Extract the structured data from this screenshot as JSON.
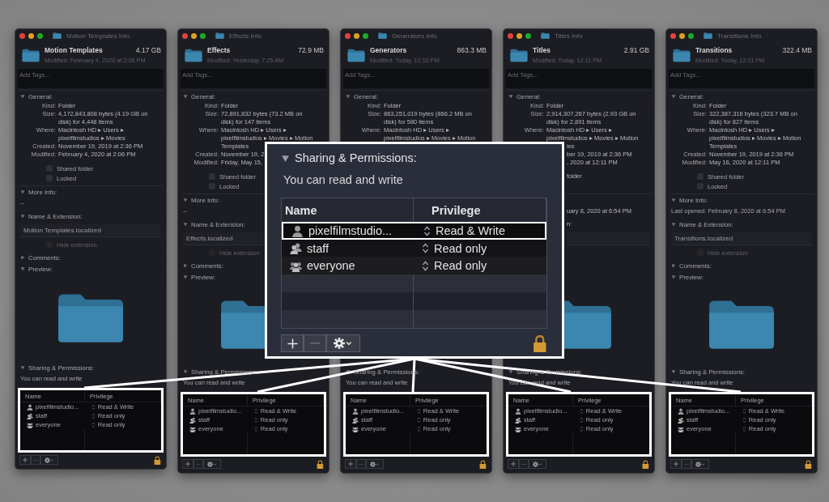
{
  "windows": [
    {
      "title": "Motion Templates Info",
      "name": "Motion Templates",
      "size": "4.17 GB",
      "modified": "Modified: February 4, 2020 at 2:06 PM",
      "tags": {
        "placeholder": "Add Tags..."
      },
      "general": {
        "title": "General:",
        "expanded": true,
        "rows": [
          {
            "label": "Kind:",
            "lines": [
              "Folder"
            ]
          },
          {
            "label": "Size:",
            "lines": [
              "4,172,843,808 bytes (4.19 GB on",
              "disk) for 4,448 items"
            ]
          },
          {
            "label": "Where:",
            "lines": [
              "Macintosh HD ▸ Users ▸",
              "pixelfilmstudios ▸ Movies"
            ]
          },
          {
            "label": "Created:",
            "lines": [
              "November 19, 2019 at 2:36 PM"
            ]
          },
          {
            "label": "Modified:",
            "lines": [
              "February 4, 2020 at 2:06 PM"
            ]
          }
        ],
        "options": [
          {
            "label": "Shared folder",
            "checked": false
          },
          {
            "label": "Locked",
            "checked": false
          }
        ]
      },
      "more_info": {
        "title": "More Info:",
        "expanded": true,
        "lines": [
          "--"
        ]
      },
      "name_ext": {
        "title": "Name & Extension:",
        "expanded": true,
        "value": "Motion Templates.localized",
        "hide_extension": {
          "label": "Hide extension",
          "checked": false,
          "disabled": true
        }
      },
      "comments": {
        "title": "Comments:",
        "expanded": false
      },
      "preview": {
        "title": "Preview:",
        "expanded": true,
        "kind": "folder"
      },
      "sharing": {
        "title": "Sharing & Permissions:",
        "expanded": true,
        "note": "You can read and write",
        "highlighted": true,
        "columns": [
          "Name",
          "Privilege"
        ],
        "rows": [
          {
            "name": "pixelfilmstudio...",
            "kind": "user",
            "privilege": "Read & Write"
          },
          {
            "name": "staff",
            "kind": "group",
            "privilege": "Read only"
          },
          {
            "name": "everyone",
            "kind": "everyone",
            "privilege": "Read only"
          }
        ]
      }
    },
    {
      "title": "Effects Info",
      "name": "Effects",
      "size": "72.9 MB",
      "modified": "Modified: Yesterday, 7:25 AM",
      "tags": {
        "placeholder": "Add Tags..."
      },
      "general": {
        "title": "General:",
        "expanded": true,
        "rows": [
          {
            "label": "Kind:",
            "lines": [
              "Folder"
            ]
          },
          {
            "label": "Size:",
            "lines": [
              "72,891,832 bytes (73.2 MB on",
              "disk) for 147 items"
            ]
          },
          {
            "label": "Where:",
            "lines": [
              "Macintosh HD ▸ Users ▸",
              "pixelfilmstudios ▸ Movies ▸ Motion",
              "Templates"
            ]
          },
          {
            "label": "Created:",
            "lines": [
              "November 19, 2"
            ]
          },
          {
            "label": "Modified:",
            "lines": [
              "Friday, May 15,"
            ]
          }
        ],
        "options": [
          {
            "label": "Shared folder",
            "checked": false
          },
          {
            "label": "Locked",
            "checked": false
          }
        ]
      },
      "more_info": {
        "title": "More Info:",
        "expanded": true,
        "lines": [
          "--"
        ]
      },
      "name_ext": {
        "title": "Name & Extension:",
        "expanded": true,
        "value": "Effects.localized",
        "hide_extension": {
          "label": "Hide extension",
          "checked": false,
          "disabled": true
        }
      },
      "comments": {
        "title": "Comments:",
        "expanded": false
      },
      "preview": {
        "title": "Preview:",
        "expanded": true,
        "kind": "folder"
      },
      "sharing": {
        "title": "Sharing & Permissions:",
        "expanded": true,
        "note": "You can read and write",
        "highlighted": true,
        "columns": [
          "Name",
          "Privilege"
        ],
        "rows": [
          {
            "name": "pixelfilmstudio...",
            "kind": "user",
            "privilege": "Read & Write"
          },
          {
            "name": "staff",
            "kind": "group",
            "privilege": "Read only"
          },
          {
            "name": "everyone",
            "kind": "everyone",
            "privilege": "Read only"
          }
        ]
      }
    },
    {
      "title": "Generators Info",
      "name": "Generators",
      "size": "863.3 MB",
      "modified": "Modified: Today, 12:10 PM",
      "tags": {
        "placeholder": "Add Tags..."
      },
      "general": {
        "title": "General:",
        "expanded": true,
        "rows": [
          {
            "label": "Kind:",
            "lines": [
              "Folder"
            ]
          },
          {
            "label": "Size:",
            "lines": [
              "863,251,019 bytes (866.2 MB on",
              "disk) for 580 items"
            ]
          },
          {
            "label": "Where:",
            "lines": [
              "Macintosh HD ▸ Users ▸",
              "pixelfilmstudios ▸ Movies ▸ Motion"
            ]
          }
        ]
      },
      "sharing": {
        "title": "Sharing & Permissions:",
        "expanded": true,
        "note": "You can read and write",
        "highlighted": true,
        "columns": [
          "Name",
          "Privilege"
        ],
        "rows": [
          {
            "name": "pixelfilmstudio...",
            "kind": "user",
            "privilege": "Read & Write"
          },
          {
            "name": "staff",
            "kind": "group",
            "privilege": "Read only"
          },
          {
            "name": "everyone",
            "kind": "everyone",
            "privilege": "Read only"
          }
        ]
      }
    },
    {
      "title": "Titles Info",
      "name": "Titles",
      "size": "2.91 GB",
      "modified": "Modified: Today, 12:11 PM",
      "tags": {
        "placeholder": "Add Tags..."
      },
      "general": {
        "title": "General:",
        "expanded": true,
        "rows": [
          {
            "label": "Kind:",
            "lines": [
              "Folder"
            ]
          },
          {
            "label": "Size:",
            "lines": [
              "2,914,307,267 bytes (2.93 GB on",
              "disk) for 2,891 items"
            ]
          },
          {
            "label": "Where:",
            "lines": [
              "Macintosh HD ▸ Users ▸",
              "pixelfilmstudios ▸ Movies ▸ Motion"
            ]
          },
          {
            "lines": [
              "ies"
            ],
            "clipped": true
          },
          {
            "lines": [
              "ber 19, 2019 at 2:36 PM"
            ],
            "clipped": true
          },
          {
            "lines": [
              ", 2020 at 12:11 PM"
            ],
            "clipped": true
          }
        ],
        "options": [
          {
            "label": "folder",
            "clipped": true
          }
        ]
      },
      "more_info": {
        "lines": [
          "uary 8, 2020 at 6:54 PM"
        ],
        "clipped": true
      },
      "name_ext": {
        "title": "n:",
        "clipped": true
      },
      "preview": {
        "kind": "folder"
      },
      "sharing": {
        "title": "Sharing & Permissions:",
        "expanded": true,
        "note": "You can read and write",
        "highlighted": true,
        "columns": [
          "Name",
          "Privilege"
        ],
        "rows": [
          {
            "name": "pixelfilmstudio...",
            "kind": "user",
            "privilege": "Read & Write"
          },
          {
            "name": "staff",
            "kind": "group",
            "privilege": "Read only"
          },
          {
            "name": "everyone",
            "kind": "everyone",
            "privilege": "Read only"
          }
        ]
      }
    },
    {
      "title": "Transitions Info",
      "name": "Transitions",
      "size": "322.4 MB",
      "modified": "Modified: Today, 12:11 PM",
      "tags": {
        "placeholder": "Add Tags..."
      },
      "general": {
        "title": "General:",
        "expanded": true,
        "rows": [
          {
            "label": "Kind:",
            "lines": [
              "Folder"
            ]
          },
          {
            "label": "Size:",
            "lines": [
              "322,387,316 bytes (323.7 MB on",
              "disk) for 827 items"
            ]
          },
          {
            "label": "Where:",
            "lines": [
              "Macintosh HD ▸ Users ▸",
              "pixelfilmstudios ▸ Movies ▸ Motion",
              "Templates"
            ]
          },
          {
            "label": "Created:",
            "lines": [
              "November 19, 2019 at 2:36 PM"
            ]
          },
          {
            "label": "Modified:",
            "lines": [
              "May 16, 2020 at 12:11 PM"
            ]
          }
        ],
        "options": [
          {
            "label": "Shared folder",
            "checked": false
          },
          {
            "label": "Locked",
            "checked": false
          }
        ]
      },
      "more_info": {
        "title": "More Info:",
        "expanded": true,
        "lines": [
          "Last opened: February 8, 2020 at 6:54 PM"
        ]
      },
      "name_ext": {
        "title": "Name & Extension:",
        "expanded": true,
        "value": "Transitions.localized",
        "hide_extension": {
          "label": "Hide extension",
          "checked": false,
          "disabled": true
        }
      },
      "comments": {
        "title": "Comments:",
        "expanded": false
      },
      "preview": {
        "title": "Preview:",
        "expanded": true,
        "kind": "folder"
      },
      "sharing": {
        "title": "Sharing & Permissions:",
        "expanded": true,
        "note": "You can read and write",
        "highlighted": true,
        "columns": [
          "Name",
          "Privilege"
        ],
        "rows": [
          {
            "name": "pixelfilmstudio...",
            "kind": "user",
            "privilege": "Read & Write"
          },
          {
            "name": "staff",
            "kind": "group",
            "privilege": "Read only"
          },
          {
            "name": "everyone",
            "kind": "everyone",
            "privilege": "Read only"
          }
        ]
      }
    }
  ],
  "callout": {
    "title": "Sharing & Permissions:",
    "expanded": true,
    "note": "You can read and write",
    "columns": [
      "Name",
      "Privilege"
    ],
    "rows": [
      {
        "name": "pixelfilmstudio...",
        "kind": "user",
        "privilege": "Read & Write",
        "selected": true
      },
      {
        "name": "staff",
        "kind": "group",
        "privilege": "Read only",
        "selected": false
      },
      {
        "name": "everyone",
        "kind": "everyone",
        "privilege": "Read only",
        "selected": false
      }
    ]
  }
}
